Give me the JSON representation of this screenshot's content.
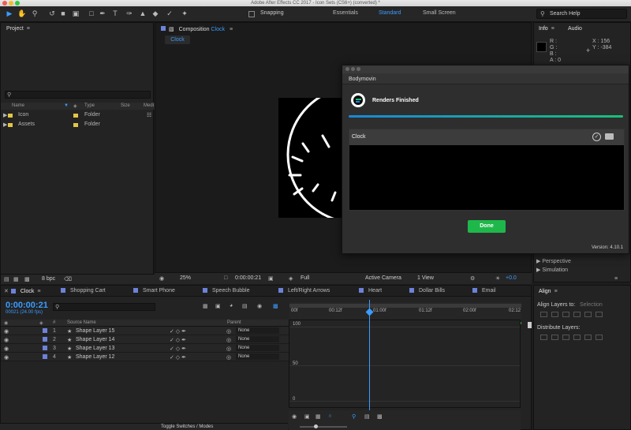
{
  "app": {
    "title": "Adobe After Effects CC 2017 - Icon Sets (CS6+) (converted) *"
  },
  "toolbar": {
    "snapping_label": "Snapping",
    "workspaces": [
      "Essentials",
      "Standard",
      "Small Screen"
    ],
    "active_workspace": "Standard",
    "search_placeholder": "Search Help"
  },
  "project": {
    "title": "Project",
    "columns": {
      "name": "Name",
      "type": "Type",
      "size": "Size",
      "media": "Medi"
    },
    "items": [
      {
        "name": "Icon",
        "type": "Folder"
      },
      {
        "name": "Assets",
        "type": "Folder"
      }
    ],
    "bpc": "8 bpc"
  },
  "composition": {
    "panel_title": "Composition",
    "comp_name": "Clock",
    "tab_label": "Clock",
    "footer": {
      "zoom": "25%",
      "timecode": "0:00:00:21",
      "resolution": "Full",
      "camera": "Active Camera",
      "view": "1 View",
      "exposure": "+0.0"
    }
  },
  "bodymovin": {
    "title": "Bodymovin",
    "status": "Renders Finished",
    "progress": 1.0,
    "item_name": "Clock",
    "done_label": "Done",
    "version": "Version: 4.10.1"
  },
  "info": {
    "tabs": [
      "Info",
      "Audio"
    ],
    "labels": [
      "R :",
      "G :",
      "B :",
      "A : 0"
    ],
    "x_readout": "X : 156",
    "y_readout": "Y : -384",
    "panel_items": [
      "Perspective",
      "Simulation"
    ]
  },
  "timeline": {
    "active_tab": "Clock",
    "tabs": [
      "Shopping Cart",
      "Smart Phone",
      "Speech Bubble",
      "Left/Right Arrows",
      "Heart",
      "Dollar Bills",
      "Email"
    ],
    "current_time": "0:00:00:21",
    "fps": "00021 (24.00 fps)",
    "columns": {
      "hash": "#",
      "source": "Source Name",
      "parent": "Parent"
    },
    "layers": [
      {
        "num": "1",
        "name": "Shape Layer 15",
        "parent": "None"
      },
      {
        "num": "2",
        "name": "Shape Layer 14",
        "parent": "None"
      },
      {
        "num": "3",
        "name": "Shape Layer 13",
        "parent": "None"
      },
      {
        "num": "4",
        "name": "Shape Layer 12",
        "parent": "None"
      }
    ],
    "ruler": [
      "00f",
      "00:12f",
      "01:00f",
      "01:12f",
      "02:00f",
      "02:12"
    ],
    "graph_values": [
      "100",
      "50",
      "0"
    ],
    "toggle_label": "Toggle Switches / Modes"
  },
  "align": {
    "title": "Align",
    "align_to_label": "Align Layers to:",
    "align_to_value": "Selection",
    "distribute_label": "Distribute Layers:"
  },
  "colors": {
    "accent": "#3a9cff",
    "done": "#1eb84a",
    "layer_label": "#6d82d9"
  }
}
